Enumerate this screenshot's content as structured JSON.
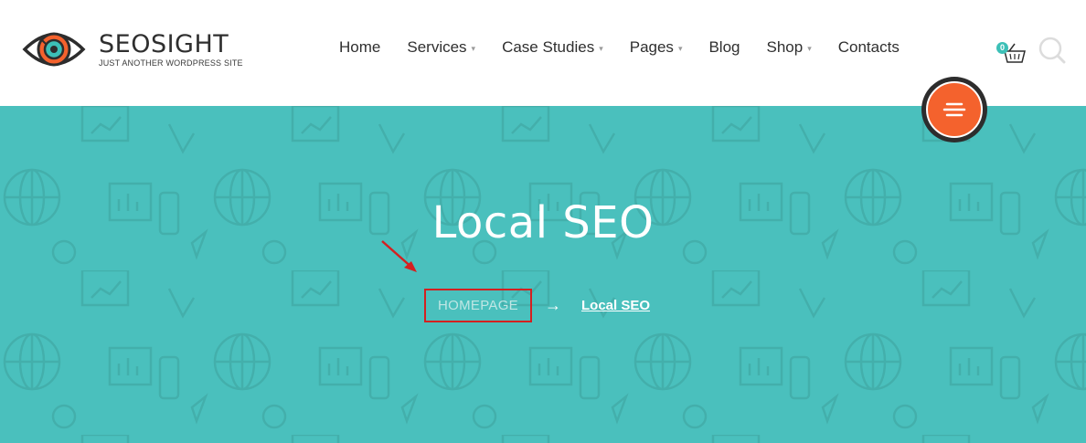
{
  "site": {
    "name": "SEOSIGHT",
    "tagline": "JUST ANOTHER WORDPRESS SITE"
  },
  "nav": {
    "items": [
      {
        "label": "Home",
        "dropdown": false
      },
      {
        "label": "Services",
        "dropdown": true
      },
      {
        "label": "Case Studies",
        "dropdown": true
      },
      {
        "label": "Pages",
        "dropdown": true
      },
      {
        "label": "Blog",
        "dropdown": false
      },
      {
        "label": "Shop",
        "dropdown": true
      },
      {
        "label": "Contacts",
        "dropdown": false
      }
    ]
  },
  "cart": {
    "count": "0",
    "icon": "basket-icon"
  },
  "search": {
    "icon": "search-icon"
  },
  "hero": {
    "title": "Local SEO",
    "background_color": "#4ac0bd"
  },
  "breadcrumbs": {
    "home": "HOMEPAGE",
    "separator": "→",
    "current": "Local SEO"
  },
  "colors": {
    "accent": "#f4622d",
    "teal": "#3cc0b7",
    "annotation": "#d42020"
  }
}
